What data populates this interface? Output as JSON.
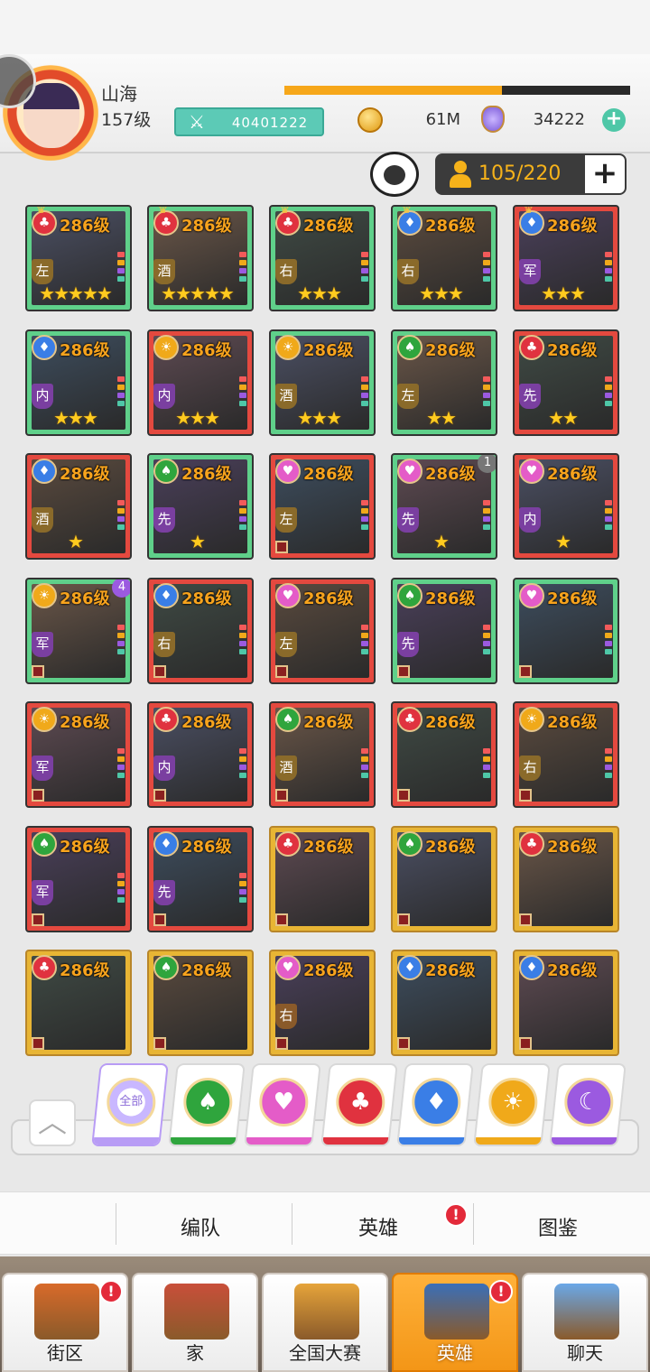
{
  "player": {
    "name": "山海",
    "level": "157级",
    "exp_fraction": 0.63,
    "power": "40401222",
    "coins": "61M",
    "gems": "34222"
  },
  "roster": {
    "capacity": "105/220"
  },
  "heroes": [
    {
      "level": "286级",
      "suit": "club",
      "role": "左",
      "stars": 5,
      "frame": "green",
      "crown": true
    },
    {
      "level": "286级",
      "suit": "club",
      "role": "酒",
      "stars": 5,
      "frame": "green",
      "crown": true
    },
    {
      "level": "286级",
      "suit": "club",
      "role": "右",
      "stars": 3,
      "frame": "green",
      "crown": true
    },
    {
      "level": "286级",
      "suit": "diamond",
      "role": "右",
      "stars": 3,
      "frame": "green",
      "crown": true
    },
    {
      "level": "286级",
      "suit": "diamond",
      "role": "军",
      "stars": 3,
      "frame": "red",
      "crown": true
    },
    {
      "level": "286级",
      "suit": "diamond",
      "role": "内",
      "stars": 3,
      "frame": "green"
    },
    {
      "level": "286级",
      "suit": "sun",
      "role": "内",
      "stars": 3,
      "frame": "red"
    },
    {
      "level": "286级",
      "suit": "sun",
      "role": "酒",
      "stars": 3,
      "frame": "green"
    },
    {
      "level": "286级",
      "suit": "spade",
      "role": "左",
      "stars": 2,
      "frame": "green"
    },
    {
      "level": "286级",
      "suit": "club",
      "role": "先",
      "stars": 2,
      "frame": "red"
    },
    {
      "level": "286级",
      "suit": "diamond",
      "role": "酒",
      "stars": 1,
      "frame": "red"
    },
    {
      "level": "286级",
      "suit": "spade",
      "role": "先",
      "stars": 1,
      "frame": "green"
    },
    {
      "level": "286级",
      "suit": "heart",
      "role": "左",
      "stars": 0,
      "frame": "red"
    },
    {
      "level": "286级",
      "suit": "heart",
      "role": "先",
      "stars": 1,
      "frame": "green",
      "badge": "1"
    },
    {
      "level": "286级",
      "suit": "heart",
      "role": "内",
      "stars": 1,
      "frame": "red"
    },
    {
      "level": "286级",
      "suit": "sun",
      "role": "军",
      "stars": 0,
      "frame": "green",
      "badge": "4"
    },
    {
      "level": "286级",
      "suit": "diamond",
      "role": "右",
      "stars": 0,
      "frame": "red"
    },
    {
      "level": "286级",
      "suit": "heart",
      "role": "左",
      "stars": 0,
      "frame": "red"
    },
    {
      "level": "286级",
      "suit": "spade",
      "role": "先",
      "stars": 0,
      "frame": "green"
    },
    {
      "level": "286级",
      "suit": "heart",
      "role": "",
      "stars": 0,
      "frame": "green"
    },
    {
      "level": "286级",
      "suit": "sun",
      "role": "军",
      "stars": 0,
      "frame": "red"
    },
    {
      "level": "286级",
      "suit": "club",
      "role": "内",
      "stars": 0,
      "frame": "red"
    },
    {
      "level": "286级",
      "suit": "spade",
      "role": "酒",
      "stars": 0,
      "frame": "red"
    },
    {
      "level": "286级",
      "suit": "club",
      "role": "",
      "stars": 0,
      "frame": "red"
    },
    {
      "level": "286级",
      "suit": "sun",
      "role": "右",
      "stars": 0,
      "frame": "red"
    },
    {
      "level": "286级",
      "suit": "spade",
      "role": "军",
      "stars": 0,
      "frame": "red"
    },
    {
      "level": "286级",
      "suit": "diamond",
      "role": "先",
      "stars": 0,
      "frame": "red"
    },
    {
      "level": "286级",
      "suit": "club",
      "role": "",
      "stars": 0,
      "frame": "gold"
    },
    {
      "level": "286级",
      "suit": "spade",
      "role": "",
      "stars": 0,
      "frame": "gold"
    },
    {
      "level": "286级",
      "suit": "club",
      "role": "",
      "stars": 0,
      "frame": "gold"
    },
    {
      "level": "286级",
      "suit": "club",
      "role": "",
      "stars": 0,
      "frame": "gold"
    },
    {
      "level": "286级",
      "suit": "spade",
      "role": "",
      "stars": 0,
      "frame": "gold"
    },
    {
      "level": "286级",
      "suit": "heart",
      "role": "右",
      "stars": 0,
      "frame": "gold"
    },
    {
      "level": "286级",
      "suit": "diamond",
      "role": "",
      "stars": 0,
      "frame": "gold"
    },
    {
      "level": "286级",
      "suit": "diamond",
      "role": "",
      "stars": 0,
      "frame": "gold"
    }
  ],
  "filters": [
    {
      "name": "all",
      "label": "全部",
      "color": "#b89cf5"
    },
    {
      "name": "spade",
      "color": "#2fa53d"
    },
    {
      "name": "heart",
      "color": "#e45cc8"
    },
    {
      "name": "club",
      "color": "#e0323f"
    },
    {
      "name": "diamond",
      "color": "#3a7ee6"
    },
    {
      "name": "sun",
      "color": "#f0a91a"
    },
    {
      "name": "moon",
      "color": "#9b5ae0"
    }
  ],
  "subnav": {
    "formation": "编队",
    "heroes": "英雄",
    "codex": "图鉴",
    "alert": "!"
  },
  "bottom_nav": [
    {
      "label": "街区",
      "icon": "signpost-icon",
      "alert": true
    },
    {
      "label": "家",
      "icon": "house-icon",
      "alert": false
    },
    {
      "label": "全国大赛",
      "icon": "trophy-icon",
      "alert": false
    },
    {
      "label": "英雄",
      "icon": "cards-icon",
      "alert": true,
      "active": true
    },
    {
      "label": "聊天",
      "icon": "chat-bubble-icon",
      "alert": false
    }
  ],
  "colors": {
    "frame_green": "#5fd08a",
    "frame_red": "#e4493f",
    "frame_gold": "#e8b534",
    "accent_orange": "#f6a71a",
    "power_teal": "#5ccab6"
  }
}
